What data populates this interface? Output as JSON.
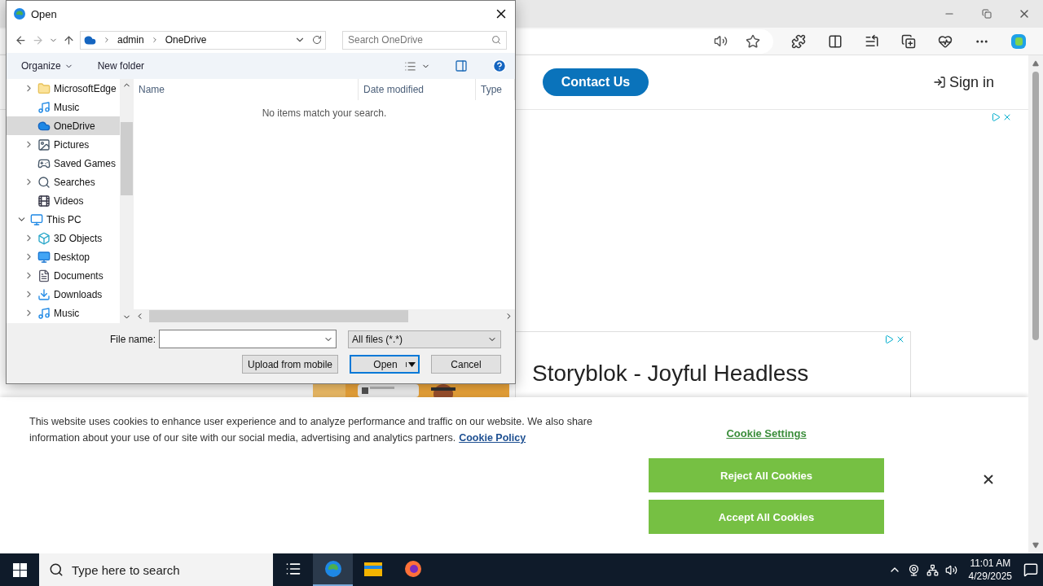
{
  "dialog": {
    "title": "Open",
    "breadcrumb": [
      "admin",
      "OneDrive"
    ],
    "search_placeholder": "Search OneDrive",
    "commands": [
      "Organize",
      "New folder"
    ],
    "tree": [
      {
        "children": [
          {
            "label": "MicrosoftEdge",
            "kind": "folder",
            "expandable": true,
            "expanded": false,
            "selected": false
          },
          {
            "label": "Music",
            "kind": "music",
            "expandable": false,
            "selected": false
          },
          {
            "label": "OneDrive",
            "kind": "cloud",
            "expandable": false,
            "selected": true
          },
          {
            "label": "Pictures",
            "kind": "pictures",
            "expandable": true,
            "expanded": false,
            "selected": false
          },
          {
            "label": "Saved Games",
            "kind": "games",
            "expandable": false,
            "selected": false
          },
          {
            "label": "Searches",
            "kind": "search",
            "expandable": true,
            "expanded": false,
            "selected": false
          },
          {
            "label": "Videos",
            "kind": "videos",
            "expandable": false,
            "selected": false
          }
        ]
      },
      {
        "label": "This PC",
        "kind": "pc",
        "expandable": true,
        "expanded": true,
        "selected": false,
        "children": [
          {
            "label": "3D Objects",
            "kind": "objects",
            "expandable": true,
            "expanded": false,
            "selected": false
          },
          {
            "label": "Desktop",
            "kind": "desktop",
            "expandable": true,
            "expanded": false,
            "selected": false
          },
          {
            "label": "Documents",
            "kind": "documents",
            "expandable": true,
            "expanded": false,
            "selected": false
          },
          {
            "label": "Downloads",
            "kind": "downloads",
            "expandable": true,
            "expanded": false,
            "selected": false
          },
          {
            "label": "Music",
            "kind": "music",
            "expandable": true,
            "expanded": false,
            "selected": false
          }
        ]
      }
    ],
    "columns": [
      "Name",
      "Date modified",
      "Type"
    ],
    "empty_message": "No items match your search.",
    "file_name_label": "File name:",
    "filter": "All files (*.*)",
    "buttons": [
      "Upload from mobile",
      "Open",
      "Cancel"
    ]
  },
  "page": {
    "contact_button": "Contact Us",
    "sign_in": "Sign in",
    "ad_headline": "Storyblok - Joyful Headless",
    "cookie_banner": {
      "text": "This website uses cookies to enhance user experience and to analyze performance and traffic on our website. We also share information about your use of our site with our social media, advertising and analytics partners.",
      "policy_link": "Cookie Policy",
      "settings_link": "Cookie Settings",
      "buttons": [
        "Reject All Cookies",
        "Accept All Cookies"
      ]
    }
  },
  "taskbar": {
    "search_placeholder": "Type here to search",
    "apps": [
      {
        "kind": "taskview",
        "selected": false
      },
      {
        "kind": "edge",
        "selected": true
      },
      {
        "kind": "explorer",
        "selected": false
      },
      {
        "kind": "firefox",
        "selected": false
      }
    ],
    "time": "11:01 AM",
    "date": "4/29/2025"
  }
}
